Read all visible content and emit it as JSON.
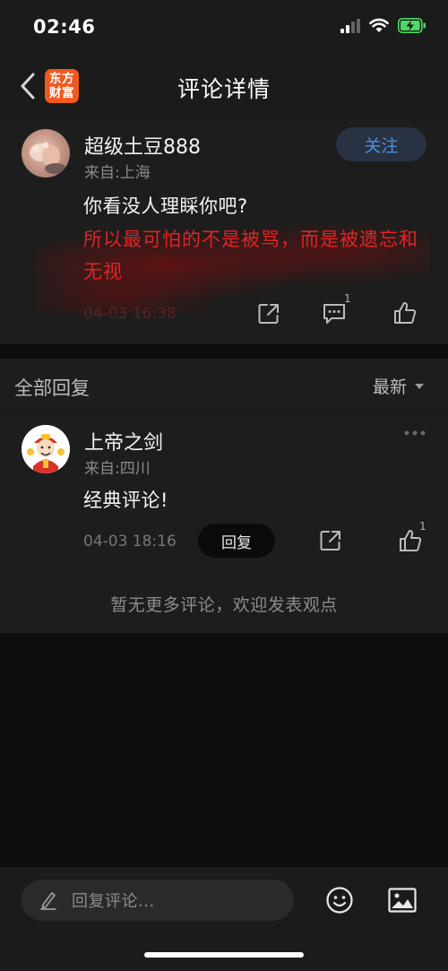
{
  "status_bar": {
    "time": "02:46"
  },
  "nav": {
    "title": "评论详情",
    "brand_line1": "东方",
    "brand_line2": "财富"
  },
  "comment": {
    "username": "超级土豆888",
    "location": "来自:上海",
    "follow_label": "关注",
    "line1": "你看没人理睬你吧?",
    "highlighted_text": "所以最可怕的不是被骂，而是被遗忘和无视",
    "timestamp": "04-03 16:38",
    "reply_count": "1"
  },
  "replies": {
    "header": "全部回复",
    "sort_label": "最新",
    "items": [
      {
        "username": "上帝之剑",
        "location": "来自:四川",
        "text": "经典评论!",
        "timestamp": "04-03 18:16",
        "reply_label": "回复",
        "like_count": "1"
      }
    ],
    "no_more_text": "暂无更多评论，欢迎发表观点"
  },
  "bottom_bar": {
    "reply_placeholder": "回复评论..."
  },
  "colors": {
    "accent_blue": "#4a8fe4",
    "highlight_red": "#e02424",
    "brand_orange": "#f0591f",
    "battery_green": "#4cd964"
  }
}
